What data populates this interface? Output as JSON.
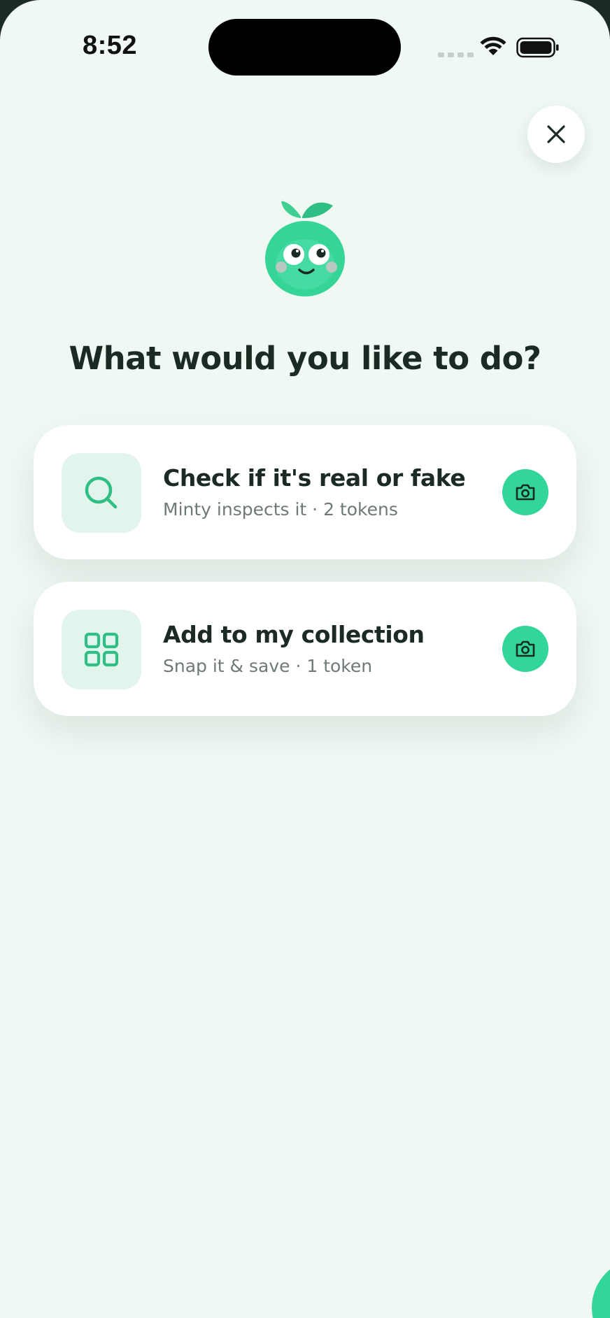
{
  "status_bar": {
    "time": "8:52"
  },
  "close": {
    "icon": "close-icon"
  },
  "mascot": {
    "name": "mascot-icon"
  },
  "title": "What would you like to do?",
  "options": [
    {
      "title": "Check if it's real or fake",
      "subtitle": "Minty inspects it · 2 tokens",
      "icon": "search-icon",
      "action_icon": "camera-icon"
    },
    {
      "title": "Add to my collection",
      "subtitle": "Snap it & save · 1 token",
      "icon": "grid-icon",
      "action_icon": "camera-icon"
    }
  ],
  "colors": {
    "background": "#eff8f3",
    "accent": "#33d699",
    "icon_tile": "#e2f5ec",
    "text_primary": "#1b2a22",
    "text_secondary": "#6f7a74"
  }
}
